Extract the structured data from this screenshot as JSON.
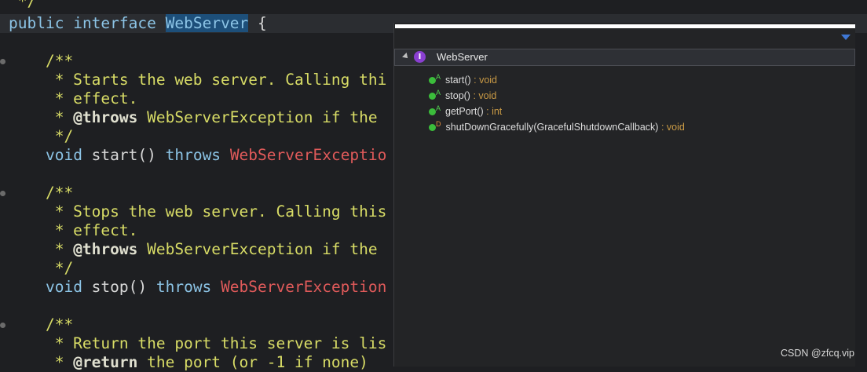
{
  "editor": {
    "lines": [
      {
        "segments": [
          {
            "t": " */",
            "c": "cmt"
          }
        ]
      },
      {
        "segments": [
          {
            "t": "public",
            "c": "kw"
          },
          {
            "t": " "
          },
          {
            "t": "interface",
            "c": "kw"
          },
          {
            "t": " "
          },
          {
            "t": "WebServer",
            "c": "sel"
          },
          {
            "t": " {"
          }
        ]
      },
      {
        "segments": [
          {
            "t": "    /**",
            "c": "cmt"
          }
        ]
      },
      {
        "segments": [
          {
            "t": "     * Starts the web server. Calling thi",
            "c": "cmt"
          }
        ]
      },
      {
        "segments": [
          {
            "t": "     * effect.",
            "c": "cmt"
          }
        ]
      },
      {
        "segments": [
          {
            "t": "     * ",
            "c": "cmt"
          },
          {
            "t": "@throws",
            "c": "tag"
          },
          {
            "t": " WebServerException if the",
            "c": "cmt"
          }
        ]
      },
      {
        "segments": [
          {
            "t": "     */",
            "c": "cmt"
          }
        ]
      },
      {
        "segments": [
          {
            "t": "    "
          },
          {
            "t": "void",
            "c": "kw"
          },
          {
            "t": " start() "
          },
          {
            "t": "throws",
            "c": "kw"
          },
          {
            "t": " "
          },
          {
            "t": "WebServerExceptio",
            "c": "err"
          }
        ]
      },
      {
        "segments": [
          {
            "t": "    /**",
            "c": "cmt"
          }
        ]
      },
      {
        "segments": [
          {
            "t": "     * Stops the web server. Calling this",
            "c": "cmt"
          }
        ]
      },
      {
        "segments": [
          {
            "t": "     * effect.",
            "c": "cmt"
          }
        ]
      },
      {
        "segments": [
          {
            "t": "     * ",
            "c": "cmt"
          },
          {
            "t": "@throws",
            "c": "tag"
          },
          {
            "t": " WebServerException if the",
            "c": "cmt"
          }
        ]
      },
      {
        "segments": [
          {
            "t": "     */",
            "c": "cmt"
          }
        ]
      },
      {
        "segments": [
          {
            "t": "    "
          },
          {
            "t": "void",
            "c": "kw"
          },
          {
            "t": " stop() "
          },
          {
            "t": "throws",
            "c": "kw"
          },
          {
            "t": " "
          },
          {
            "t": "WebServerException",
            "c": "err"
          }
        ]
      },
      {
        "segments": [
          {
            "t": "    /**",
            "c": "cmt"
          }
        ]
      },
      {
        "segments": [
          {
            "t": "     * Return the port this server is lis",
            "c": "cmt"
          }
        ]
      },
      {
        "segments": [
          {
            "t": "     * ",
            "c": "cmt"
          },
          {
            "t": "@return",
            "c": "tag"
          },
          {
            "t": " the port (or -1 if none)",
            "c": "cmt"
          }
        ]
      }
    ]
  },
  "outline": {
    "root_label": "WebServer",
    "root_icon": "interface-icon",
    "root_icon_letter": "I",
    "members": [
      {
        "icon": "public-method-icon",
        "badge": "A",
        "name": "start()",
        "type": " : void"
      },
      {
        "icon": "public-method-icon",
        "badge": "A",
        "name": "stop()",
        "type": " : void"
      },
      {
        "icon": "public-method-icon",
        "badge": "A",
        "name": "getPort()",
        "type": " : int"
      },
      {
        "icon": "public-default-method-icon",
        "badge": "D",
        "name": "shutDownGracefully(GracefulShutdownCallback)",
        "type": " : void"
      }
    ]
  },
  "watermark": "CSDN @zfcq.vip"
}
